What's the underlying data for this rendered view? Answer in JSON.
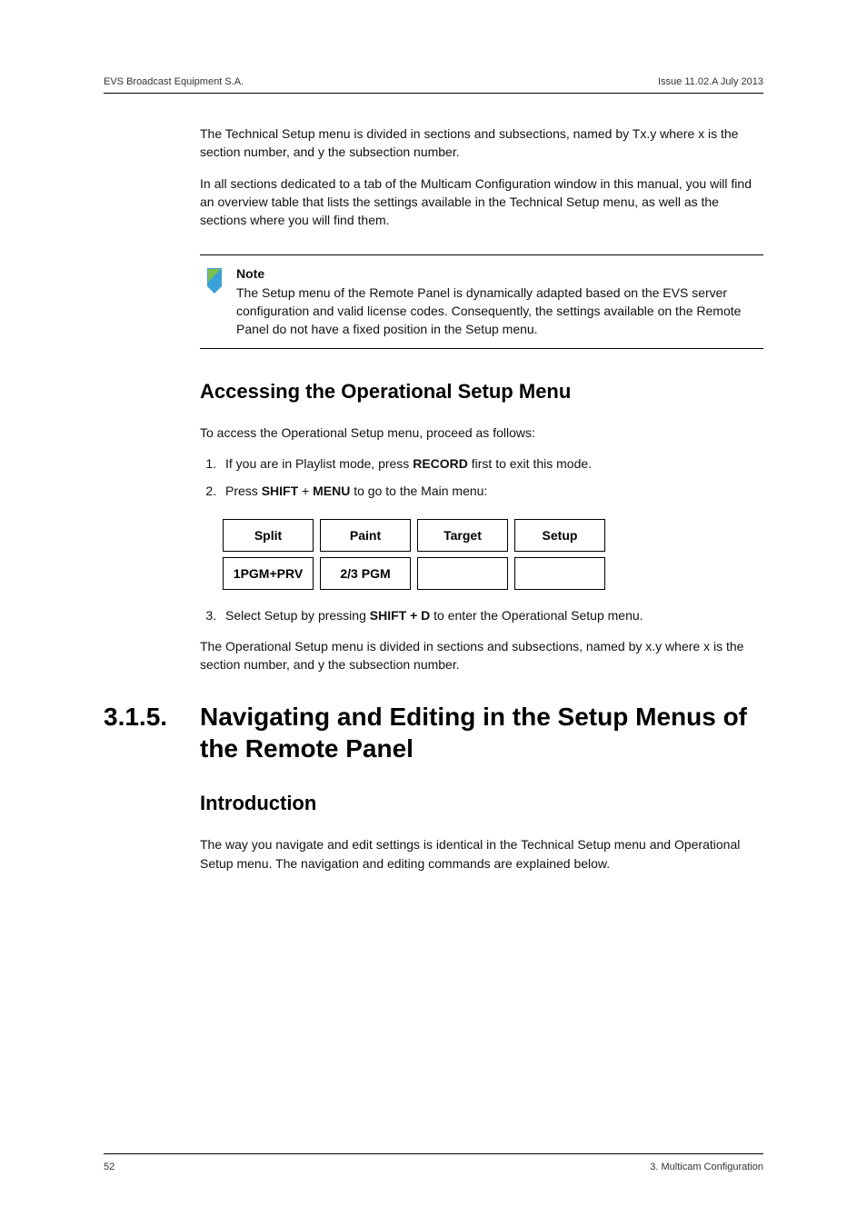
{
  "header": {
    "left": "EVS Broadcast Equipment S.A.",
    "right": "Issue 11.02.A  July 2013"
  },
  "paragraphs": {
    "p1": "The Technical Setup menu is divided in sections and subsections, named by Tx.y where x is the section number, and y the subsection number.",
    "p2": "In all sections dedicated to a tab of the Multicam Configuration window in this manual, you will find an overview table that lists the settings available in the Technical Setup menu, as well as the sections where you will find them.",
    "p3": "To access the Operational Setup menu, proceed as follows:",
    "p4": "The Operational Setup menu is divided in sections and subsections, named by x.y where x is the section number, and y the subsection number.",
    "p5": "The way you navigate and edit settings is identical in the Technical Setup menu and Operational Setup menu. The navigation and editing commands are explained below."
  },
  "note": {
    "title": "Note",
    "body": "The Setup menu of the Remote Panel is dynamically adapted based on the EVS server configuration and valid license codes. Consequently, the settings available on the Remote Panel do not have a fixed position in the Setup menu."
  },
  "headings": {
    "h2a": "Accessing the Operational Setup Menu",
    "h2b": "Introduction"
  },
  "list": {
    "li1_pre": "If you are in Playlist mode, press ",
    "li1_bold": "RECORD",
    "li1_post": " first to exit this mode.",
    "li2_pre": "Press ",
    "li2_b1": "SHIFT",
    "li2_mid": " + ",
    "li2_b2": "MENU",
    "li2_post": " to go to the Main menu:",
    "li3_pre": "Select Setup by pressing ",
    "li3_bold": "SHIFT + D",
    "li3_post": " to enter the Operational Setup menu."
  },
  "menu": {
    "r1c1": "Split",
    "r1c2": "Paint",
    "r1c3": "Target",
    "r1c4": "Setup",
    "r2c1": "1PGM+PRV",
    "r2c2": "2/3 PGM",
    "r2c3": "",
    "r2c4": ""
  },
  "section": {
    "number": "3.1.5.",
    "title": "Navigating and Editing in the Setup Menus of the Remote Panel"
  },
  "footer": {
    "left": "52",
    "right": "3. Multicam Configuration"
  }
}
